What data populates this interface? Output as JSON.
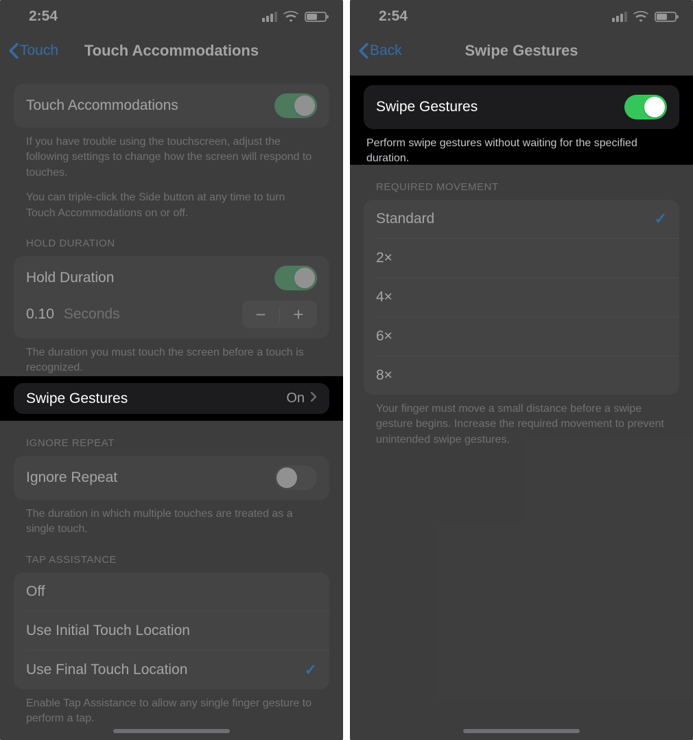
{
  "statusTime": "2:54",
  "left": {
    "backLabel": "Touch",
    "navTitle": "Touch Accommodations",
    "touchAccom": {
      "label": "Touch Accommodations"
    },
    "touchAccomNote1": "If you have trouble using the touchscreen, adjust the following settings to change how the screen will respond to touches.",
    "touchAccomNote2": "You can triple-click the Side button at any time to turn Touch Accommodations on or off.",
    "holdHeader": "HOLD DURATION",
    "holdLabel": "Hold Duration",
    "holdValue": "0.10",
    "holdUnit": "Seconds",
    "holdNote": "The duration you must touch the screen before a touch is recognized.",
    "swipeLabel": "Swipe Gestures",
    "swipeValue": "On",
    "ignoreHeader": "IGNORE REPEAT",
    "ignoreLabel": "Ignore Repeat",
    "ignoreNote": "The duration in which multiple touches are treated as a single touch.",
    "tapHeader": "TAP ASSISTANCE",
    "tapOptions": {
      "off": "Off",
      "initial": "Use Initial Touch Location",
      "final": "Use Final Touch Location"
    },
    "tapNote": "Enable Tap Assistance to allow any single finger gesture to perform a tap."
  },
  "right": {
    "backLabel": "Back",
    "navTitle": "Swipe Gestures",
    "swipeLabel": "Swipe Gestures",
    "swipeNote": "Perform swipe gestures without waiting for the specified duration.",
    "reqHeader": "REQUIRED MOVEMENT",
    "options": {
      "std": "Standard",
      "x2": "2×",
      "x4": "4×",
      "x6": "6×",
      "x8": "8×"
    },
    "reqNote": "Your finger must move a small distance before a swipe gesture begins. Increase the required movement to prevent unintended swipe gestures."
  }
}
